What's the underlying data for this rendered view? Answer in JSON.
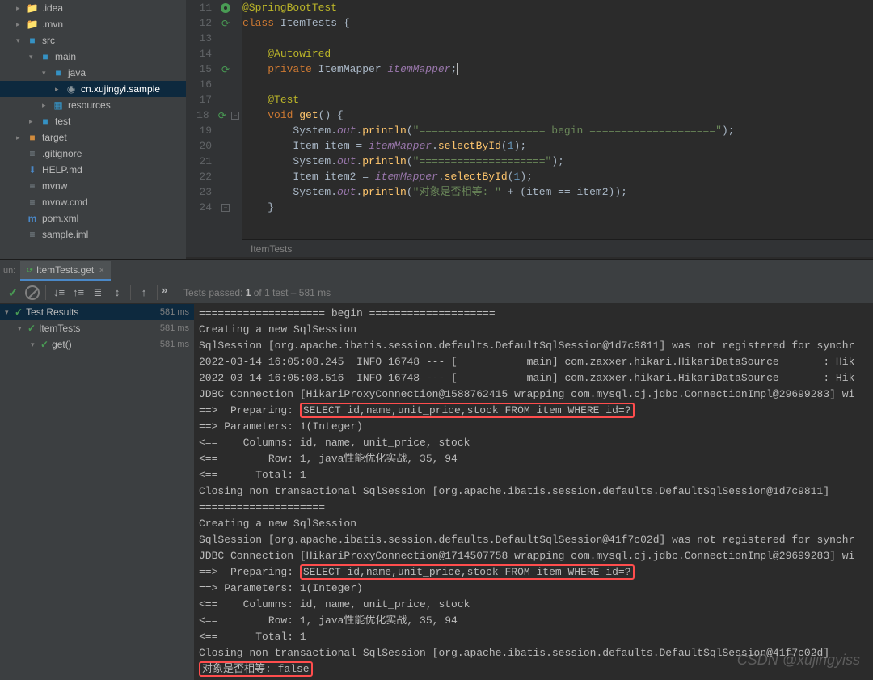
{
  "tree": {
    "items": [
      {
        "indent": 1,
        "arrow": "▸",
        "icon": "folder",
        "label": ".idea",
        "mod": true
      },
      {
        "indent": 1,
        "arrow": "▸",
        "icon": "folder",
        "label": ".mvn"
      },
      {
        "indent": 1,
        "arrow": "▾",
        "icon": "folder-blue",
        "label": "src"
      },
      {
        "indent": 2,
        "arrow": "▾",
        "icon": "folder-blue",
        "label": "main"
      },
      {
        "indent": 3,
        "arrow": "▾",
        "icon": "folder-blue",
        "label": "java"
      },
      {
        "indent": 4,
        "arrow": "▸",
        "icon": "package",
        "label": "cn.xujingyi.sample",
        "selected": true
      },
      {
        "indent": 3,
        "arrow": "▸",
        "icon": "folder-res",
        "label": "resources"
      },
      {
        "indent": 2,
        "arrow": "▸",
        "icon": "folder-blue",
        "label": "test"
      },
      {
        "indent": 1,
        "arrow": "▸",
        "icon": "folder-orange",
        "label": "target"
      },
      {
        "indent": 1,
        "arrow": "",
        "icon": "file",
        "label": ".gitignore"
      },
      {
        "indent": 1,
        "arrow": "",
        "icon": "file-md",
        "label": "HELP.md"
      },
      {
        "indent": 1,
        "arrow": "",
        "icon": "file",
        "label": "mvnw"
      },
      {
        "indent": 1,
        "arrow": "",
        "icon": "file",
        "label": "mvnw.cmd"
      },
      {
        "indent": 1,
        "arrow": "",
        "icon": "file-m",
        "label": "pom.xml"
      },
      {
        "indent": 1,
        "arrow": "",
        "icon": "file",
        "label": "sample.iml"
      }
    ]
  },
  "editor": {
    "breadcrumb": "ItemTests",
    "lines": [
      {
        "n": 11,
        "icons": [
          "leaf"
        ],
        "code": [
          [
            "ann",
            "@SpringBootTest"
          ]
        ]
      },
      {
        "n": 12,
        "icons": [
          "cycle"
        ],
        "code": [
          [
            "kw",
            "class "
          ],
          [
            "cls",
            "ItemTests {"
          ]
        ]
      },
      {
        "n": 13,
        "icons": [],
        "code": []
      },
      {
        "n": 14,
        "icons": [],
        "code": [
          [
            "sp",
            "    "
          ],
          [
            "ann",
            "@Autowired"
          ]
        ]
      },
      {
        "n": 15,
        "icons": [
          "cycle"
        ],
        "code": [
          [
            "sp",
            "    "
          ],
          [
            "kw",
            "private "
          ],
          [
            "cls",
            "ItemMapper "
          ],
          [
            "fld",
            "itemMapper"
          ],
          [
            "cls",
            ";"
          ],
          [
            "caret",
            ""
          ]
        ]
      },
      {
        "n": 16,
        "icons": [],
        "code": []
      },
      {
        "n": 17,
        "icons": [],
        "code": [
          [
            "sp",
            "    "
          ],
          [
            "ann",
            "@Test"
          ]
        ]
      },
      {
        "n": 18,
        "icons": [
          "cycle"
        ],
        "fold": "-",
        "code": [
          [
            "sp",
            "    "
          ],
          [
            "kw",
            "void "
          ],
          [
            "mth",
            "get"
          ],
          [
            "cls",
            "() {"
          ]
        ]
      },
      {
        "n": 19,
        "icons": [],
        "code": [
          [
            "sp",
            "        "
          ],
          [
            "cls",
            "System."
          ],
          [
            "out",
            "out"
          ],
          [
            "cls",
            "."
          ],
          [
            "mth",
            "println"
          ],
          [
            "cls",
            "("
          ],
          [
            "str",
            "\"==================== begin ====================\""
          ],
          [
            "cls",
            ");"
          ]
        ]
      },
      {
        "n": 20,
        "icons": [],
        "code": [
          [
            "sp",
            "        "
          ],
          [
            "cls",
            "Item item = "
          ],
          [
            "fld",
            "itemMapper"
          ],
          [
            "cls",
            "."
          ],
          [
            "mth",
            "selectById"
          ],
          [
            "cls",
            "("
          ],
          [
            "num",
            "1"
          ],
          [
            "cls",
            ");"
          ]
        ]
      },
      {
        "n": 21,
        "icons": [],
        "code": [
          [
            "sp",
            "        "
          ],
          [
            "cls",
            "System."
          ],
          [
            "out",
            "out"
          ],
          [
            "cls",
            "."
          ],
          [
            "mth",
            "println"
          ],
          [
            "cls",
            "("
          ],
          [
            "str",
            "\"====================\""
          ],
          [
            "cls",
            ");"
          ]
        ]
      },
      {
        "n": 22,
        "icons": [],
        "code": [
          [
            "sp",
            "        "
          ],
          [
            "cls",
            "Item item2 = "
          ],
          [
            "fld",
            "itemMapper"
          ],
          [
            "cls",
            "."
          ],
          [
            "mth",
            "selectById"
          ],
          [
            "cls",
            "("
          ],
          [
            "num",
            "1"
          ],
          [
            "cls",
            ");"
          ]
        ]
      },
      {
        "n": 23,
        "icons": [],
        "code": [
          [
            "sp",
            "        "
          ],
          [
            "cls",
            "System."
          ],
          [
            "out",
            "out"
          ],
          [
            "cls",
            "."
          ],
          [
            "mth",
            "println"
          ],
          [
            "cls",
            "("
          ],
          [
            "str",
            "\"对象是否相等: \""
          ],
          [
            "cls",
            " + (item == item2));"
          ]
        ]
      },
      {
        "n": 24,
        "icons": [],
        "fold": "-",
        "code": [
          [
            "sp",
            "    "
          ],
          [
            "cls",
            "}"
          ]
        ]
      }
    ]
  },
  "run": {
    "label": "un:",
    "tab": "ItemTests.get",
    "status_prefix": "Tests passed: ",
    "status_passed": "1",
    "status_of": " of 1 test – 581 ms"
  },
  "tests": [
    {
      "indent": 0,
      "label": "Test Results",
      "time": "581 ms",
      "sel": true
    },
    {
      "indent": 1,
      "label": "ItemTests",
      "time": "581 ms"
    },
    {
      "indent": 2,
      "label": "get()",
      "time": "581 ms"
    }
  ],
  "console": [
    {
      "t": "==================== begin ===================="
    },
    {
      "t": "Creating a new SqlSession"
    },
    {
      "t": "SqlSession [org.apache.ibatis.session.defaults.DefaultSqlSession@1d7c9811] was not registered for synchr"
    },
    {
      "t": "2022-03-14 16:05:08.245  INFO 16748 --- [           main] com.zaxxer.hikari.HikariDataSource       : Hik"
    },
    {
      "t": "2022-03-14 16:05:08.516  INFO 16748 --- [           main] com.zaxxer.hikari.HikariDataSource       : Hik"
    },
    {
      "t": "JDBC Connection [HikariProxyConnection@1588762415 wrapping com.mysql.cj.jdbc.ConnectionImpl@29699283] wi"
    },
    {
      "t": "==>  Preparing: ",
      "hl": "SELECT id,name,unit_price,stock FROM item WHERE id=?"
    },
    {
      "t": "==> Parameters: 1(Integer)"
    },
    {
      "t": "<==    Columns: id, name, unit_price, stock"
    },
    {
      "t": "<==        Row: 1, java性能优化实战, 35, 94"
    },
    {
      "t": "<==      Total: 1"
    },
    {
      "t": "Closing non transactional SqlSession [org.apache.ibatis.session.defaults.DefaultSqlSession@1d7c9811]"
    },
    {
      "t": "===================="
    },
    {
      "t": "Creating a new SqlSession"
    },
    {
      "t": "SqlSession [org.apache.ibatis.session.defaults.DefaultSqlSession@41f7c02d] was not registered for synchr"
    },
    {
      "t": "JDBC Connection [HikariProxyConnection@1714507758 wrapping com.mysql.cj.jdbc.ConnectionImpl@29699283] wi"
    },
    {
      "t": "==>  Preparing: ",
      "hl": "SELECT id,name,unit_price,stock FROM item WHERE id=?"
    },
    {
      "t": "==> Parameters: 1(Integer)"
    },
    {
      "t": "<==    Columns: id, name, unit_price, stock"
    },
    {
      "t": "<==        Row: 1, java性能优化实战, 35, 94"
    },
    {
      "t": "<==      Total: 1"
    },
    {
      "t": "Closing non transactional SqlSession [org.apache.ibatis.session.defaults.DefaultSqlSession@41f7c02d]"
    },
    {
      "hl_only": "对象是否相等: false"
    }
  ],
  "watermark": "CSDN @xujingyiss"
}
